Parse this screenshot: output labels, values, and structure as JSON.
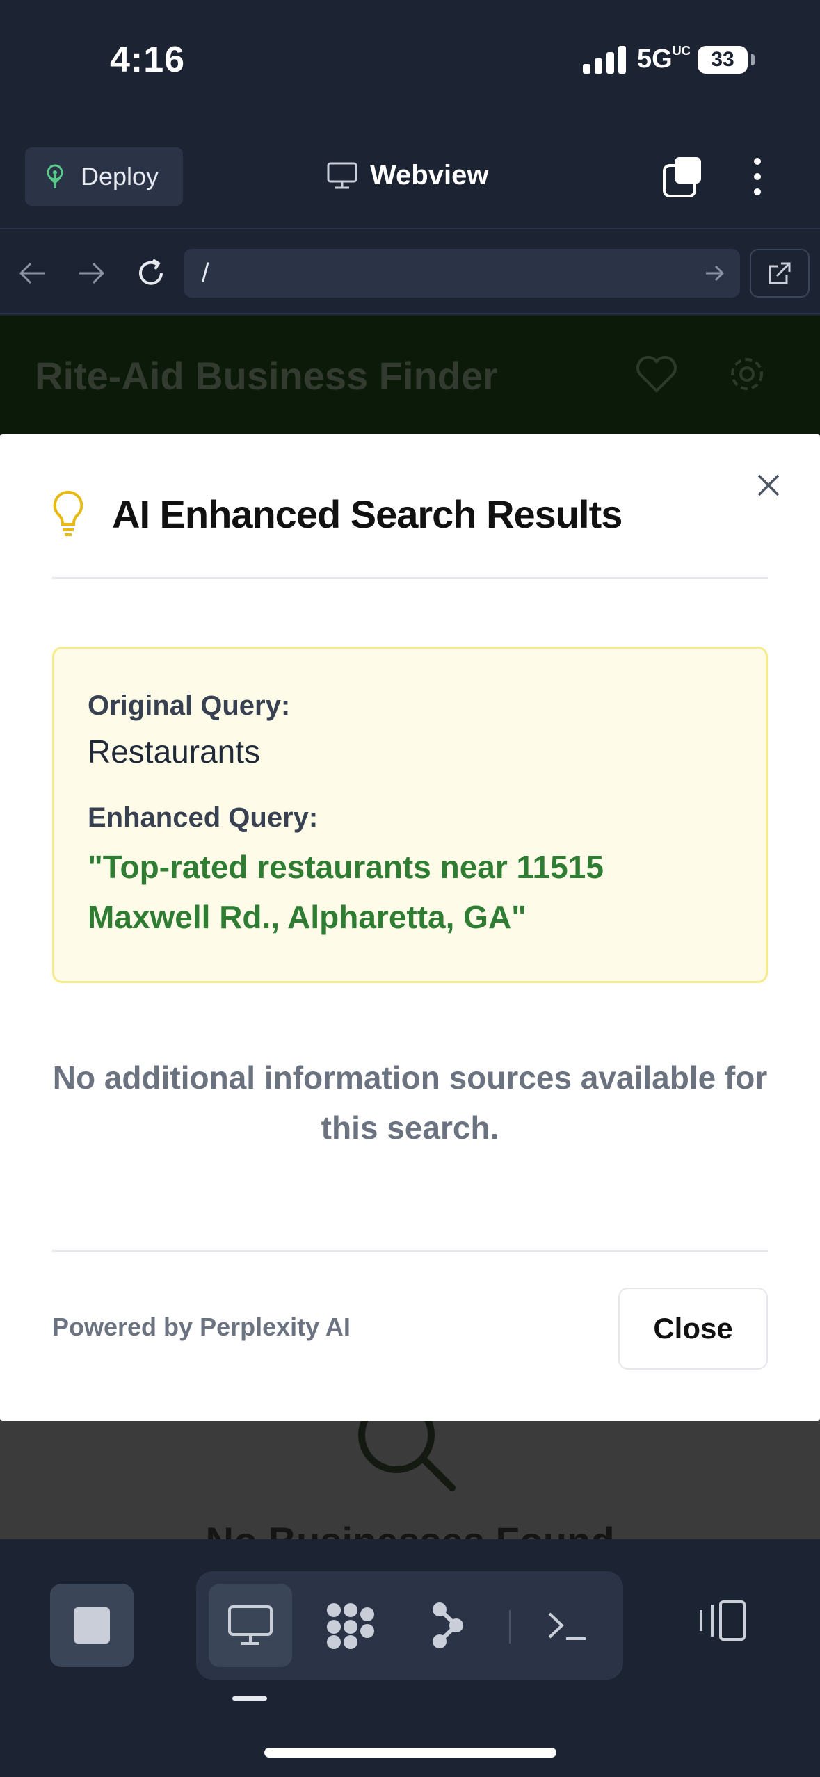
{
  "status_bar": {
    "time": "4:16",
    "network": "5G",
    "network_suffix": "UC",
    "battery": "33"
  },
  "top_bar": {
    "deploy_label": "Deploy",
    "title": "Webview"
  },
  "url_bar": {
    "value": "/"
  },
  "page": {
    "title": "Rite-Aid Business Finder",
    "empty_text": "No Businesses Found"
  },
  "modal": {
    "title": "AI Enhanced Search Results",
    "original_label": "Original Query:",
    "original_value": "Restaurants",
    "enhanced_label": "Enhanced Query:",
    "enhanced_value": "\"Top-rated restaurants near 11515 Maxwell Rd., Alpharetta, GA\"",
    "no_sources": "No additional information sources available for this search.",
    "powered_by": "Powered by Perplexity AI",
    "close_label": "Close"
  },
  "colors": {
    "app_bg": "#1c2333",
    "accent_green": "#2e7d32",
    "query_box_bg": "#fefbe8",
    "bulb_yellow": "#e8b90f"
  },
  "icons": [
    "deploy-icon",
    "monitor-icon",
    "tabs-icon",
    "kebab-icon",
    "back-arrow-icon",
    "forward-arrow-icon",
    "reload-icon",
    "go-arrow-icon",
    "external-link-icon",
    "heart-icon",
    "gear-icon",
    "lightbulb-icon",
    "close-icon",
    "search-icon",
    "stop-icon",
    "desktop-icon",
    "grid-icon",
    "branch-icon",
    "terminal-icon",
    "layout-icon"
  ]
}
